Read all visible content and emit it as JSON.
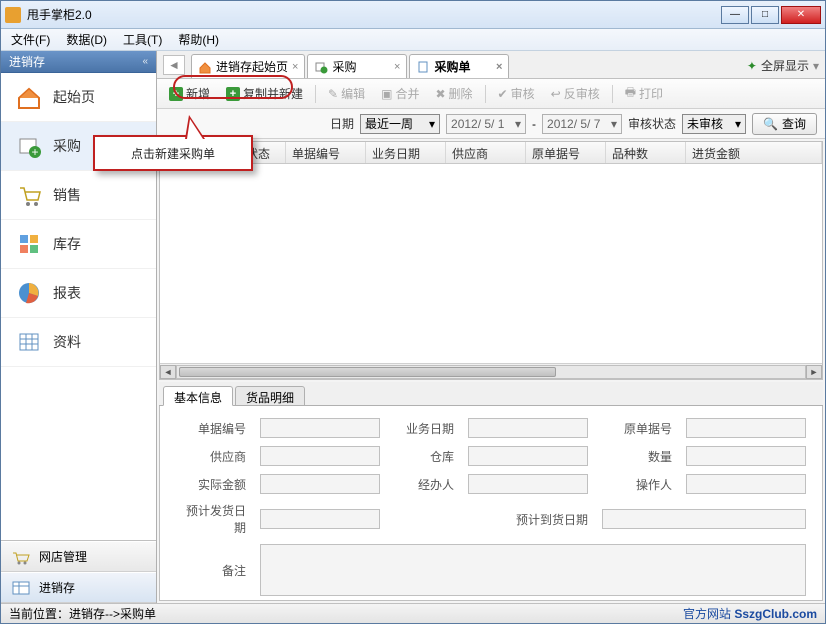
{
  "window": {
    "title": "甩手掌柜2.0"
  },
  "menu": {
    "file": "文件(F)",
    "data": "数据(D)",
    "tool": "工具(T)",
    "help": "帮助(H)"
  },
  "sidebar": {
    "header": "进销存",
    "items": [
      {
        "label": "起始页"
      },
      {
        "label": "采购"
      },
      {
        "label": "销售"
      },
      {
        "label": "库存"
      },
      {
        "label": "报表"
      },
      {
        "label": "资料"
      }
    ],
    "bottom": [
      {
        "label": "网店管理"
      },
      {
        "label": "进销存"
      }
    ]
  },
  "tabs": [
    {
      "label": "进销存起始页"
    },
    {
      "label": "采购"
    },
    {
      "label": "采购单"
    }
  ],
  "fullscreen_label": "全屏显示",
  "toolbar": {
    "new": "新增",
    "copy_new": "复制并新建",
    "edit": "编辑",
    "merge": "合并",
    "delete": "删除",
    "audit": "审核",
    "unaudit": "反审核",
    "print": "打印"
  },
  "filter": {
    "date_label": "日期",
    "range": "最近一周",
    "date_from": "2012/ 5/ 1",
    "date_to": "2012/ 5/ 7",
    "status_label": "审核状态",
    "status_value": "未审核",
    "search": "查询"
  },
  "grid_headers": [
    "",
    "",
    "审核状态",
    "单据编号",
    "业务日期",
    "供应商",
    "原单据号",
    "品种数",
    "进货金额"
  ],
  "detail_tabs": [
    "基本信息",
    "货品明细"
  ],
  "form": {
    "doc_no": "单据编号",
    "biz_date": "业务日期",
    "orig_no": "原单据号",
    "supplier": "供应商",
    "warehouse": "仓库",
    "qty": "数量",
    "amount": "实际金额",
    "handler": "经办人",
    "operator": "操作人",
    "plan_ship": "预计发货日期",
    "plan_arrive": "预计到货日期",
    "remark": "备注"
  },
  "callout": "点击新建采购单",
  "status": {
    "left_label": "当前位置：",
    "left_path": "进销存-->采购单",
    "right_site": "官方网站",
    "right_url": "SszgClub.com"
  }
}
